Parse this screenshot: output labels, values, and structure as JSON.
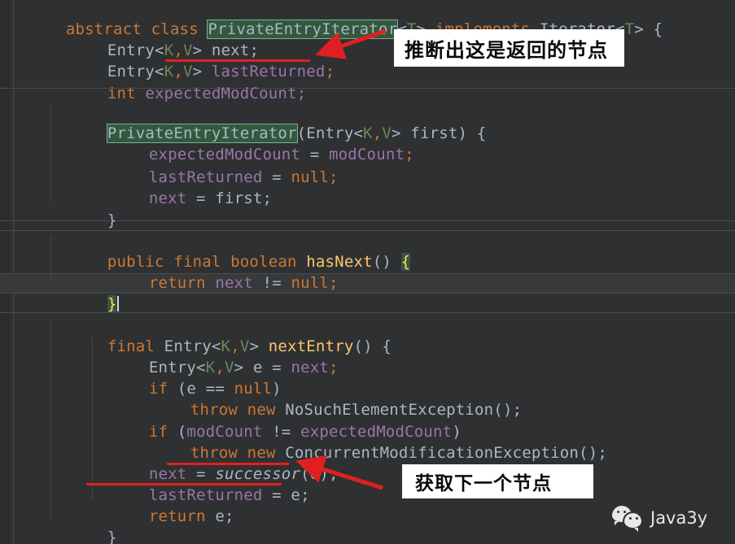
{
  "window": {
    "theme": "darcula",
    "background_color": "#2f3032",
    "default_text_color": "#a9b7c6",
    "keyword_color": "#cc7832",
    "method_color": "#ffc66d",
    "field_color": "#9876aa",
    "generic_color": "#6a8759",
    "highlight_color": "#32593d",
    "annotation_color": "#e02020"
  },
  "code": {
    "language": "Java",
    "lines": [
      {
        "indent": 0,
        "text": "abstract class PrivateEntryIterator<T> implements Iterator<T> {"
      },
      {
        "indent": 1,
        "text": "Entry<K,V> next;"
      },
      {
        "indent": 1,
        "text": "Entry<K,V> lastReturned;"
      },
      {
        "indent": 1,
        "text": "int expectedModCount;"
      },
      {
        "indent": 0,
        "text": ""
      },
      {
        "indent": 1,
        "text": "PrivateEntryIterator(Entry<K,V> first) {"
      },
      {
        "indent": 2,
        "text": "expectedModCount = modCount;"
      },
      {
        "indent": 2,
        "text": "lastReturned = null;"
      },
      {
        "indent": 2,
        "text": "next = first;"
      },
      {
        "indent": 1,
        "text": "}"
      },
      {
        "indent": 0,
        "text": ""
      },
      {
        "indent": 1,
        "text": "public final boolean hasNext() {"
      },
      {
        "indent": 2,
        "text": "return next != null;"
      },
      {
        "indent": 1,
        "text": "}"
      },
      {
        "indent": 0,
        "text": ""
      },
      {
        "indent": 1,
        "text": "final Entry<K,V> nextEntry() {"
      },
      {
        "indent": 2,
        "text": "Entry<K,V> e = next;"
      },
      {
        "indent": 2,
        "text": "if (e == null)"
      },
      {
        "indent": 3,
        "text": "throw new NoSuchElementException();"
      },
      {
        "indent": 2,
        "text": "if (modCount != expectedModCount)"
      },
      {
        "indent": 3,
        "text": "throw new ConcurrentModificationException();"
      },
      {
        "indent": 2,
        "text": "next = successor(e);"
      },
      {
        "indent": 2,
        "text": "lastReturned = e;"
      },
      {
        "indent": 2,
        "text": "return e;"
      },
      {
        "indent": 1,
        "text": "}"
      }
    ],
    "tokens": {
      "l0_kw_abstract": "abstract",
      "l0_kw_class": "class",
      "l0_class_name": "PrivateEntryIterator",
      "l0_lt": "<",
      "l0_generic": "T",
      "l0_gt": "> ",
      "l0_kw_implements": "implements",
      "l0_iterator": " Iterator<",
      "l0_generic2": "T",
      "l0_tail": "> {",
      "l1_type": "Entry<",
      "l1_k": "K",
      "l1_comma": ",",
      "l1_v": "V",
      "l1_rest": "> next;",
      "l2_type": "Entry<",
      "l2_k": "K",
      "l2_comma": ",",
      "l2_v": "V",
      "l2_gt": "> ",
      "l2_field": "lastReturned",
      "l2_semi": ";",
      "l3_kw_int": "int",
      "l3_field": " expectedModCount;",
      "l5_ctor": "PrivateEntryIterator",
      "l5_open": "(Entry<",
      "l5_k": "K",
      "l5_comma": ",",
      "l5_v": "V",
      "l5_rest": "> first) {",
      "l6_field1": "expectedModCount",
      "l6_eq": " = ",
      "l6_field2": "modCount",
      "l6_semi": ";",
      "l7_field": "lastReturned",
      "l7_eq": " = ",
      "l7_null": "null",
      "l7_semi": ";",
      "l8_field": "next",
      "l8_eq": " = first;",
      "l9_brace": "}",
      "l11_kw": "public final boolean ",
      "l11_mth": "hasNext",
      "l11_paren": "() ",
      "l11_brace": "{",
      "l12_kw_return": "return",
      "l12_field": " next",
      "l12_op": " != ",
      "l12_null": "null",
      "l12_semi": ";",
      "l13_brace": "}",
      "l15_kw_final": "final",
      "l15_type": " Entry<",
      "l15_k": "K",
      "l15_comma": ",",
      "l15_v": "V",
      "l15_gt": "> ",
      "l15_mth": "nextEntry",
      "l15_rest": "() {",
      "l16_type": "Entry<",
      "l16_k": "K",
      "l16_comma": ",",
      "l16_v": "V",
      "l16_gt": "> e = ",
      "l16_field": "next",
      "l16_semi": ";",
      "l17_kw_if": "if",
      "l17_cond": " (e == ",
      "l17_null": "null",
      "l17_close": ")",
      "l18_kw_throw": "throw",
      "l18_kw_new": " new",
      "l18_exc": " NoSuchElementException();",
      "l19_kw_if": "if",
      "l19_open": " (",
      "l19_field1": "modCount",
      "l19_op": " != ",
      "l19_field2": "expectedModCount",
      "l19_close": ")",
      "l20_kw_throw": "throw",
      "l20_kw_new": " new",
      "l20_exc": " ConcurrentModificationException();",
      "l21_field": "next",
      "l21_eq": " = ",
      "l21_mth": "successor",
      "l21_rest": "(e);",
      "l22_field": "lastReturned",
      "l22_eq": " = e;",
      "l23_kw_return": "return",
      "l23_rest": " e;",
      "l24_brace": "}"
    }
  },
  "annotations": [
    {
      "id": "callout-1",
      "text": "推断出这是返回的节点",
      "target": "lastReturned field declaration"
    },
    {
      "id": "callout-2",
      "text": "获取下一个节点",
      "target": "next = successor(e)"
    }
  ],
  "watermark": {
    "label": "Java3y",
    "icon": "wechat-icon"
  }
}
